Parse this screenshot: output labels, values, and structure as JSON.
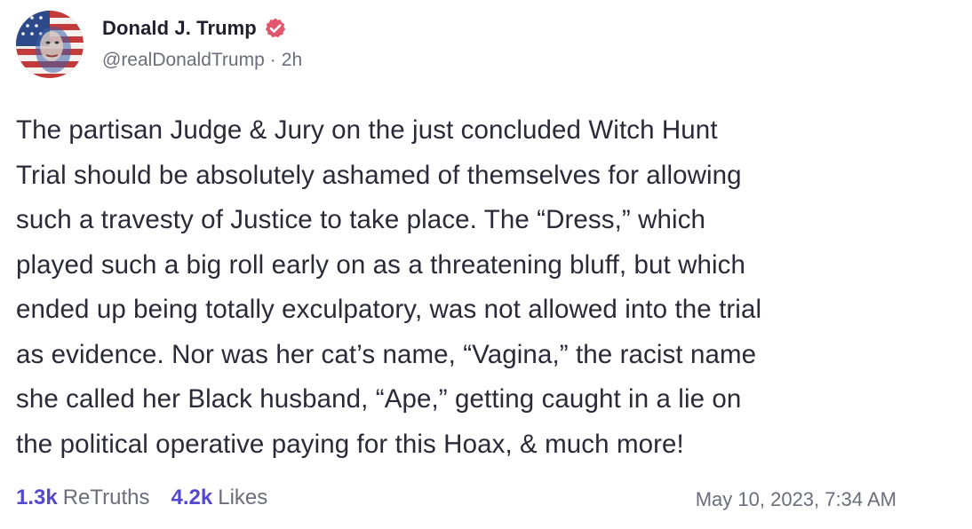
{
  "author": {
    "display_name": "Donald J. Trump",
    "handle": "@realDonaldTrump",
    "separator": "·",
    "age": "2h",
    "verified_icon": "verified-badge-icon",
    "verified_color": "#e2566b"
  },
  "post": {
    "text": "The partisan Judge & Jury on the just concluded Witch Hunt\nTrial should be absolutely ashamed of themselves for allowing\nsuch a travesty of Justice to take place. The “Dress,” which\nplayed such a big roll early on as a threatening bluff, but which\nended up being totally exculpatory, was not allowed into the trial\nas evidence. Nor was her cat’s name, “Vagina,” the racist name\nshe called her Black husband, “Ape,” getting caught in a lie on\nthe political operative paying for this Hoax, & much more!"
  },
  "stats": {
    "retruths_count": "1.3k",
    "retruths_label": "ReTruths",
    "likes_count": "4.2k",
    "likes_label": "Likes",
    "accent_color": "#5448d1"
  },
  "timestamp": "May 10, 2023, 7:34 AM"
}
